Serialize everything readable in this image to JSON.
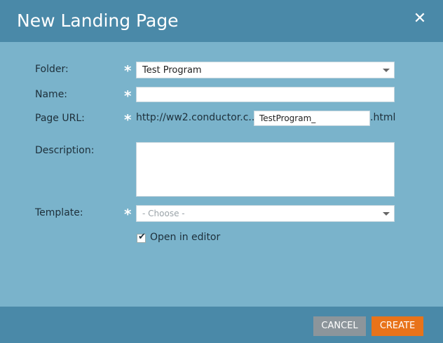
{
  "dialog": {
    "title": "New Landing Page",
    "close_glyph": "✕"
  },
  "form": {
    "folder": {
      "label": "Folder:",
      "value": "Test Program"
    },
    "name": {
      "label": "Name:",
      "value": ""
    },
    "page_url": {
      "label": "Page URL:",
      "prefix": "http://ww2.conductor.c...",
      "value": "TestProgram_",
      "suffix": ".html"
    },
    "description": {
      "label": "Description:",
      "value": ""
    },
    "template": {
      "label": "Template:",
      "placeholder": "- Choose -"
    },
    "open_in_editor": {
      "label": "Open in editor",
      "checked": true
    }
  },
  "required_marker": "*",
  "footer": {
    "cancel_label": "CANCEL",
    "create_label": "CREATE"
  },
  "colors": {
    "header": "#4a89a8",
    "body": "#7ab3cb",
    "create_button": "#e8731a",
    "cancel_button": "#8c959b"
  }
}
